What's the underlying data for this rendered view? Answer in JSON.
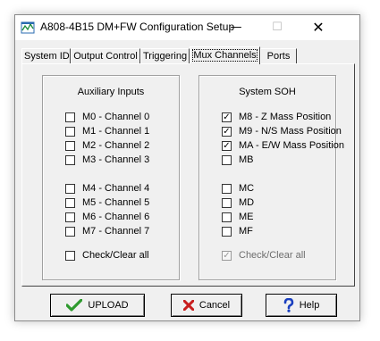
{
  "window": {
    "title": "A808-4B15 DM+FW Configuration Setup",
    "minimize_glyph": "—",
    "maximize_glyph": "☐",
    "close_glyph": "✕"
  },
  "tabs": [
    {
      "label": "System ID",
      "active": false
    },
    {
      "label": "Output Control",
      "active": false
    },
    {
      "label": "Triggering",
      "active": false
    },
    {
      "label": "Mux Channels",
      "active": true
    },
    {
      "label": "Ports",
      "active": false
    }
  ],
  "auxiliary": {
    "title": "Auxiliary Inputs",
    "items": [
      {
        "label": "M0 - Channel 0",
        "checked": false
      },
      {
        "label": "M1 - Channel 1",
        "checked": false
      },
      {
        "label": "M2 - Channel 2",
        "checked": false
      },
      {
        "label": "M3 - Channel 3",
        "checked": false
      },
      {
        "label": "M4 - Channel 4",
        "checked": false
      },
      {
        "label": "M5 - Channel 5",
        "checked": false
      },
      {
        "label": "M6 - Channel 6",
        "checked": false
      },
      {
        "label": "M7 - Channel 7",
        "checked": false
      }
    ],
    "check_clear": {
      "label": "Check/Clear all",
      "checked": false,
      "disabled": false
    }
  },
  "soh": {
    "title": "System SOH",
    "items": [
      {
        "label": "M8 - Z Mass Position",
        "checked": true
      },
      {
        "label": "M9 - N/S Mass Position",
        "checked": true
      },
      {
        "label": "MA - E/W Mass Position",
        "checked": true
      },
      {
        "label": "MB",
        "checked": false
      },
      {
        "label": "MC",
        "checked": false
      },
      {
        "label": "MD",
        "checked": false
      },
      {
        "label": "ME",
        "checked": false
      },
      {
        "label": "MF",
        "checked": false
      }
    ],
    "check_clear": {
      "label": "Check/Clear all",
      "checked": true,
      "disabled": true
    }
  },
  "buttons": {
    "upload": {
      "label": "UPLOAD",
      "icon": "green-checkmark-icon"
    },
    "cancel": {
      "label": "Cancel",
      "icon": "red-x-icon"
    },
    "help": {
      "label": "Help",
      "icon": "question-mark-icon"
    }
  },
  "colors": {
    "check_green": "#2e9a2e",
    "cancel_red": "#c81e1e",
    "help_blue": "#1a3fbf"
  }
}
